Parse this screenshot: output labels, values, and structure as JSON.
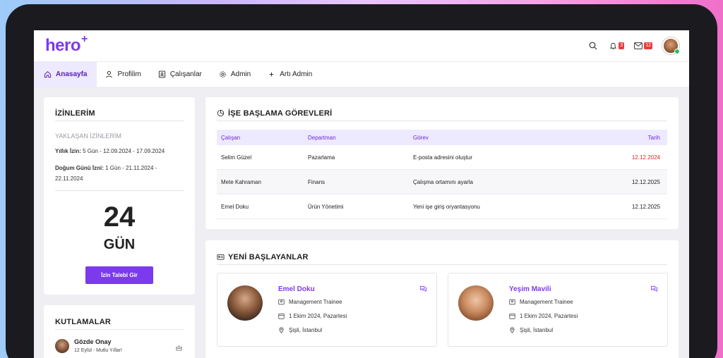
{
  "app": {
    "logo": "hero",
    "logo_plus": "+"
  },
  "header": {
    "bell_count": "3",
    "mail_count": "12"
  },
  "nav": [
    {
      "label": "Anasayfa",
      "icon": "home-icon",
      "active": true
    },
    {
      "label": "Profilim",
      "icon": "user-icon"
    },
    {
      "label": "Çalışanlar",
      "icon": "id-card-icon"
    },
    {
      "label": "Admin",
      "icon": "gear-icon"
    },
    {
      "label": "Artı Admin",
      "icon": "plus-icon"
    }
  ],
  "leave": {
    "title": "İZİNLERİM",
    "upcoming_title": "YAKLAŞAN İZİNLERİM",
    "annual_label": "Yıllık İzin:",
    "annual_value": " 5 Gün - 12.09.2024 - 17.09.2024",
    "birthday_label": "Doğum Günü İzni:",
    "birthday_value": " 1 Gün - 21.11.2024 -",
    "birthday_value2": "22.11.2024",
    "days": "24",
    "days_unit": "GÜN",
    "button": "İzin Talebi Gir"
  },
  "celebrations": {
    "title": "KUTLAMALAR",
    "items": [
      {
        "name": "Gözde Onay",
        "text": "12 Eylül - Mutlu Yıllar!"
      }
    ]
  },
  "tasks": {
    "title": "İŞE BAŞLAMA GÖREVLERİ",
    "headers": [
      "Çalışan",
      "Departman",
      "Görev",
      "Tarih"
    ],
    "rows": [
      {
        "employee": "Selim Güzel",
        "department": "Pazarlama",
        "task": "E-posta adresini oluştur",
        "date": "12.12.2024",
        "overdue": true
      },
      {
        "employee": "Mete Kahraman",
        "department": "Finans",
        "task": "Çalışma ortamını ayarla",
        "date": "12.12.2025"
      },
      {
        "employee": "Emel Doku",
        "department": "Ürün Yönetimi",
        "task": "Yeni işe giriş oryantasyonu",
        "date": "12.12.2025"
      }
    ]
  },
  "newhires": {
    "title": "YENİ BAŞLAYANLAR",
    "people": [
      {
        "name": "Emel Doku",
        "role": "Management Trainee",
        "date": "1 Ekim 2024, Pazartesi",
        "location": "Şişli, İstanbul"
      },
      {
        "name": "Yeşim Mavili",
        "role": "Management Trainee",
        "date": "1 Ekim 2024, Pazartesi",
        "location": "Şişli, İstanbul"
      }
    ]
  },
  "colors": {
    "accent": "#7c3aed",
    "overdue": "#dc2626",
    "online": "#22c55e"
  }
}
